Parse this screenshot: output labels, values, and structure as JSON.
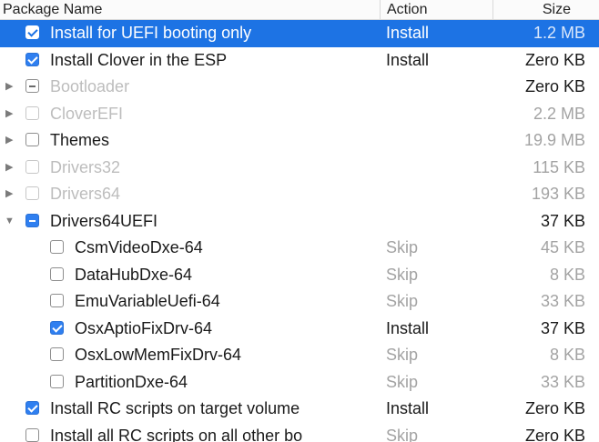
{
  "header": {
    "package_name": "Package Name",
    "action": "Action",
    "size": "Size"
  },
  "rows": [
    {
      "name": "Install for UEFI booting only",
      "action": "Install",
      "size": "1.2 MB",
      "checkbox": "checked",
      "disclosure": "none",
      "indent": 0,
      "selected": true,
      "name_style": "white",
      "action_style": "white",
      "size_style": "white-dim"
    },
    {
      "name": "Install Clover in the ESP",
      "action": "Install",
      "size": "Zero KB",
      "checkbox": "checked",
      "disclosure": "none",
      "indent": 0,
      "selected": false,
      "name_style": "dark",
      "action_style": "dark",
      "size_style": "dark"
    },
    {
      "name": "Bootloader",
      "action": "",
      "size": "Zero KB",
      "checkbox": "mixed-disabled",
      "disclosure": "collapsed",
      "indent": 0,
      "selected": false,
      "name_style": "light",
      "action_style": "light",
      "size_style": "dark"
    },
    {
      "name": "CloverEFI",
      "action": "",
      "size": "2.2 MB",
      "checkbox": "disabled",
      "disclosure": "collapsed",
      "indent": 0,
      "selected": false,
      "name_style": "light",
      "action_style": "light",
      "size_style": "gray"
    },
    {
      "name": "Themes",
      "action": "",
      "size": "19.9 MB",
      "checkbox": "unchecked",
      "disclosure": "collapsed",
      "indent": 0,
      "selected": false,
      "name_style": "dark",
      "action_style": "gray",
      "size_style": "gray"
    },
    {
      "name": "Drivers32",
      "action": "",
      "size": "115 KB",
      "checkbox": "disabled",
      "disclosure": "collapsed",
      "indent": 0,
      "selected": false,
      "name_style": "light",
      "action_style": "light",
      "size_style": "gray"
    },
    {
      "name": "Drivers64",
      "action": "",
      "size": "193 KB",
      "checkbox": "disabled",
      "disclosure": "collapsed",
      "indent": 0,
      "selected": false,
      "name_style": "light",
      "action_style": "light",
      "size_style": "gray"
    },
    {
      "name": "Drivers64UEFI",
      "action": "",
      "size": "37 KB",
      "checkbox": "mixed",
      "disclosure": "expanded",
      "indent": 0,
      "selected": false,
      "name_style": "dark",
      "action_style": "gray",
      "size_style": "dark"
    },
    {
      "name": "CsmVideoDxe-64",
      "action": "Skip",
      "size": "45 KB",
      "checkbox": "unchecked",
      "disclosure": "none",
      "indent": 1,
      "selected": false,
      "name_style": "dark",
      "action_style": "gray",
      "size_style": "gray"
    },
    {
      "name": "DataHubDxe-64",
      "action": "Skip",
      "size": "8 KB",
      "checkbox": "unchecked",
      "disclosure": "none",
      "indent": 1,
      "selected": false,
      "name_style": "dark",
      "action_style": "gray",
      "size_style": "gray"
    },
    {
      "name": "EmuVariableUefi-64",
      "action": "Skip",
      "size": "33 KB",
      "checkbox": "unchecked",
      "disclosure": "none",
      "indent": 1,
      "selected": false,
      "name_style": "dark",
      "action_style": "gray",
      "size_style": "gray"
    },
    {
      "name": "OsxAptioFixDrv-64",
      "action": "Install",
      "size": "37 KB",
      "checkbox": "checked",
      "disclosure": "none",
      "indent": 1,
      "selected": false,
      "name_style": "dark",
      "action_style": "dark",
      "size_style": "dark"
    },
    {
      "name": "OsxLowMemFixDrv-64",
      "action": "Skip",
      "size": "8 KB",
      "checkbox": "unchecked",
      "disclosure": "none",
      "indent": 1,
      "selected": false,
      "name_style": "dark",
      "action_style": "gray",
      "size_style": "gray"
    },
    {
      "name": "PartitionDxe-64",
      "action": "Skip",
      "size": "33 KB",
      "checkbox": "unchecked",
      "disclosure": "none",
      "indent": 1,
      "selected": false,
      "name_style": "dark",
      "action_style": "gray",
      "size_style": "gray"
    },
    {
      "name": "Install RC scripts on target volume",
      "action": "Install",
      "size": "Zero KB",
      "checkbox": "checked",
      "disclosure": "none",
      "indent": 0,
      "selected": false,
      "name_style": "dark",
      "action_style": "dark",
      "size_style": "dark"
    },
    {
      "name": "Install all RC scripts on all other bo",
      "action": "Skip",
      "size": "Zero KB",
      "checkbox": "unchecked",
      "disclosure": "none",
      "indent": 0,
      "selected": false,
      "name_style": "dark",
      "action_style": "gray",
      "size_style": "dark"
    }
  ]
}
